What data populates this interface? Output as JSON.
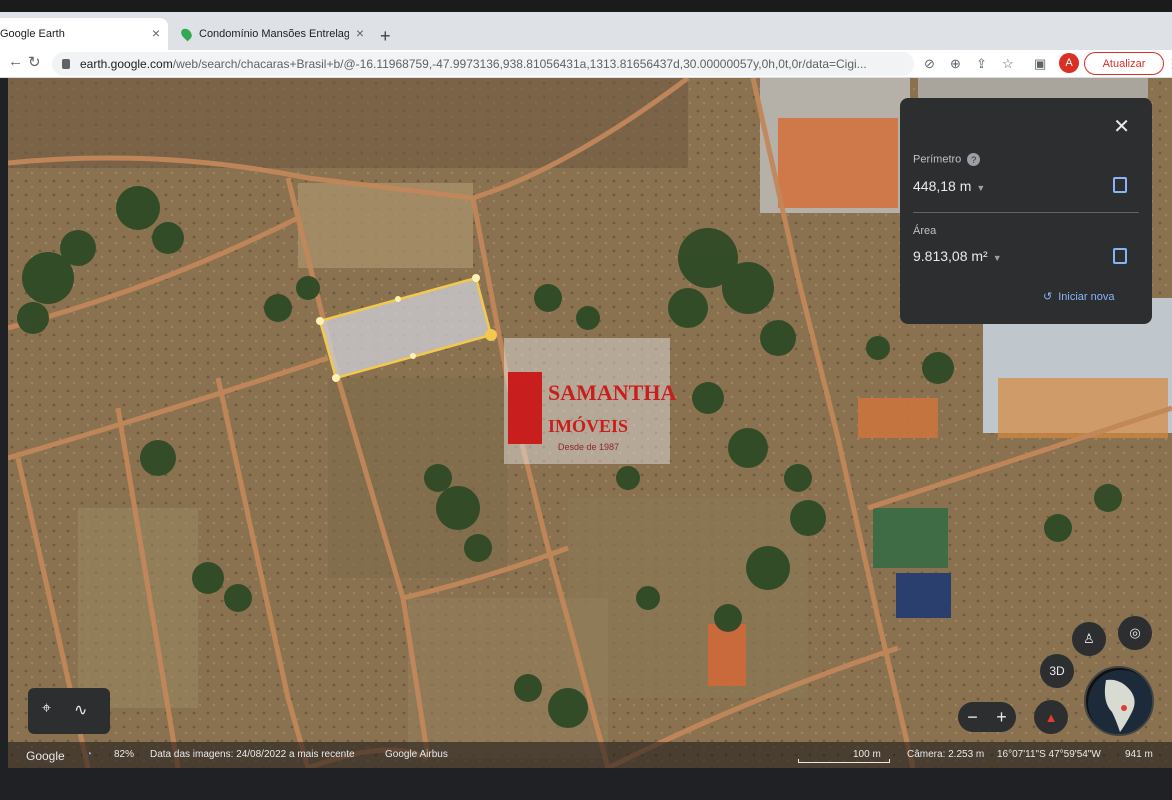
{
  "browser": {
    "tabs": [
      {
        "title": "Google Earth",
        "close": "×",
        "active": true
      },
      {
        "title": "Condomínio Mansões Entrelag",
        "close": "×",
        "active": false
      }
    ],
    "new_tab": "+",
    "url_host": "earth.google.com",
    "url_rest": "/web/search/chacaras+Brasil+b/@-16.11968759,-47.9973136,938.81056431a,1313.81656437d,30.00000057y,0h,0t,0r/data=Cigi...",
    "avatar_letter": "A",
    "update_label": "Atualizar",
    "icons": [
      "back-arrow-icon",
      "reload-icon",
      "lock-icon",
      "extension-icon",
      "zoom-icon",
      "share-icon",
      "star-icon",
      "sidepanel-icon",
      "menu-icon"
    ]
  },
  "measure_panel": {
    "perimeter_label": "Perímetro",
    "perimeter_value": "448,18 m",
    "area_label": "Área",
    "area_value": "9.813,08 m²",
    "restart_label": "Iniciar nova"
  },
  "watermark": {
    "line1": "SAMANTHA",
    "line2": "IMÓVEIS",
    "line3": "Desde de 1987"
  },
  "map_controls": {
    "three_d_label": "3D",
    "zoom_out": "−",
    "zoom_in": "+"
  },
  "status_bar": {
    "brand": "Google",
    "load_percent": "82%",
    "imagery_date": "Data das imagens: 24/08/2022 a mais recente",
    "credits": "Google  Airbus",
    "scale": "100 m",
    "camera": "Câmera: 2.253 m",
    "coords": "16°07'11\"S 47°59'54\"W",
    "elevation": "941 m"
  },
  "colors": {
    "accent_red": "#d93025",
    "panel_bg": "#2d2e30",
    "link_blue": "#8ab4f8",
    "polygon_stroke": "#f2c94c"
  }
}
